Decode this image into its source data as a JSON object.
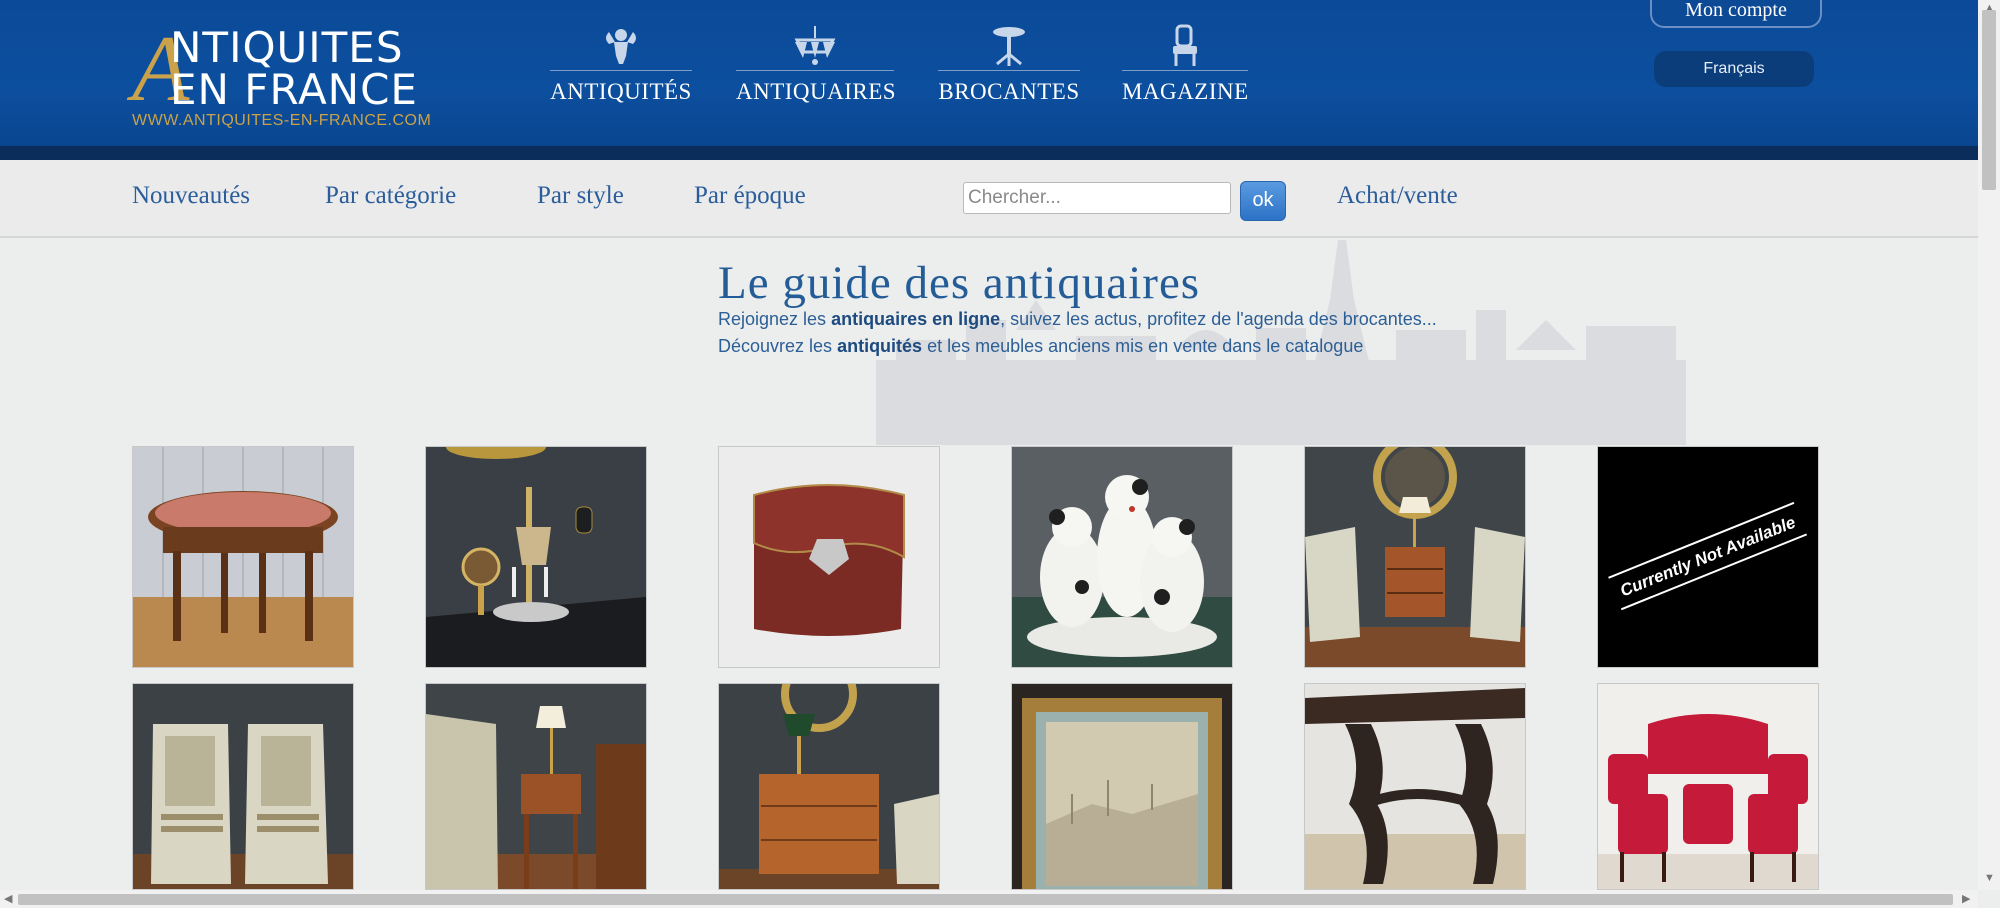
{
  "header": {
    "logo": {
      "letter": "A",
      "line1": "NTIQUITES",
      "line2": "EN FRANCE",
      "url": "WWW.ANTIQUITES-EN-FRANCE.COM"
    },
    "main_nav": [
      {
        "label": "ANTIQUITÉS",
        "icon": "cherub-icon"
      },
      {
        "label": "ANTIQUAIRES",
        "icon": "chandelier-icon"
      },
      {
        "label": "BROCANTES",
        "icon": "pedestal-table-icon"
      },
      {
        "label": "MAGAZINE",
        "icon": "armchair-icon"
      }
    ],
    "account_label": "Mon compte",
    "language_label": "Français"
  },
  "subnav": {
    "links": [
      "Nouveautés",
      "Par catégorie",
      "Par style",
      "Par époque"
    ],
    "search_placeholder": "Chercher...",
    "search_button": "ok",
    "achat_vente": "Achat/vente"
  },
  "main": {
    "title": "Le guide des antiquaires",
    "intro_line1": {
      "before": "Rejoignez les ",
      "bold": "antiquaires en ligne",
      "after": ", suivez les actus, profitez de l'agenda des brocantes..."
    },
    "intro_line2": {
      "before": "Découvrez les ",
      "bold": "antiquités",
      "after": " et les meubles anciens mis en vente dans le catalogue"
    },
    "products_row1": [
      {
        "name": "round-marble-gueridon-thumbnail"
      },
      {
        "name": "bouillotte-lamp-thumbnail"
      },
      {
        "name": "red-leather-wallet-thumbnail"
      },
      {
        "name": "porcelain-terrier-dogs-thumbnail"
      },
      {
        "name": "night-table-and-chairs-thumbnail"
      },
      {
        "name": "unavailable-thumbnail",
        "overlay_text": "Currently Not Available"
      }
    ],
    "products_row2": [
      {
        "name": "pair-of-cane-armchairs-thumbnail"
      },
      {
        "name": "small-side-table-thumbnail"
      },
      {
        "name": "chest-of-drawers-thumbnail"
      },
      {
        "name": "framed-watercolor-thumbnail"
      },
      {
        "name": "carved-console-thumbnail"
      },
      {
        "name": "red-salon-set-thumbnail"
      }
    ]
  },
  "colors": {
    "header_blue": "#0c4f9f",
    "link_blue": "#2a5d9a",
    "logo_gold": "#c9a24a"
  }
}
